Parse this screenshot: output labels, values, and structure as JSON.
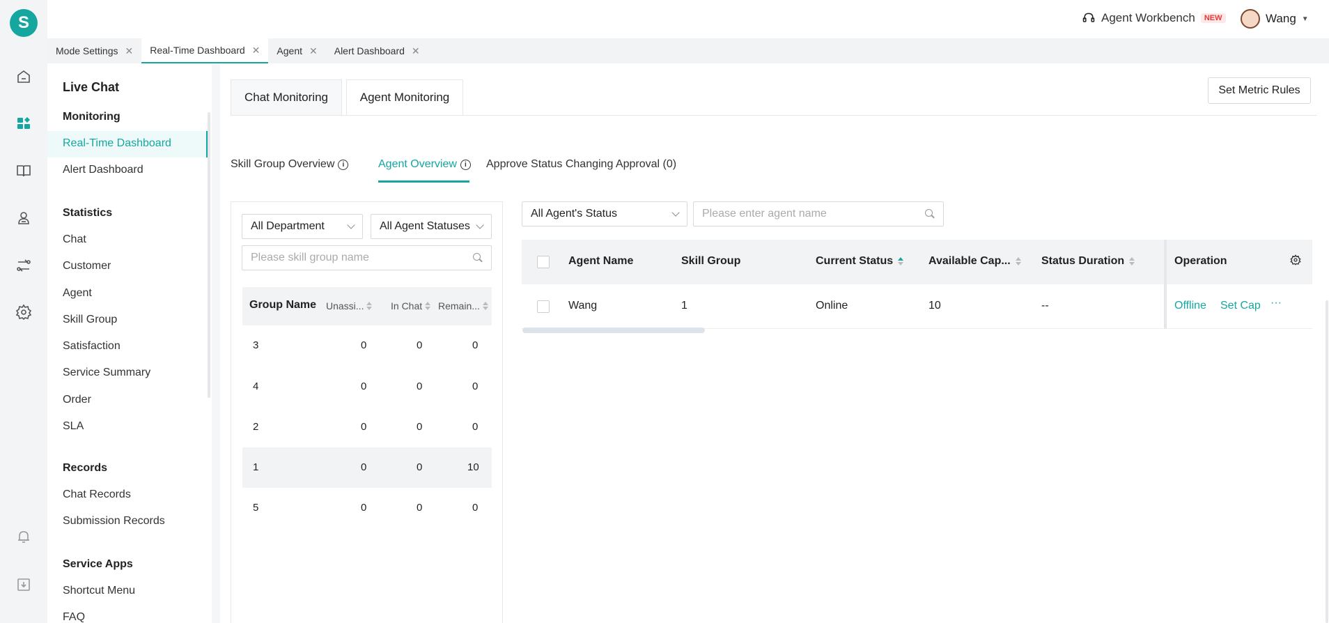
{
  "rail": {
    "logo_letter": "S",
    "icons": [
      "home-icon",
      "dashboard-icon",
      "knowledge-book-icon",
      "agent-person-icon",
      "routing-icon",
      "settings-gear-icon",
      "bell-icon",
      "download-icon"
    ]
  },
  "header": {
    "workbench_label": "Agent Workbench",
    "new_badge": "NEW",
    "user_name": "Wang"
  },
  "tabs": [
    {
      "label": "Mode Settings",
      "active": false
    },
    {
      "label": "Real-Time Dashboard",
      "active": true
    },
    {
      "label": "Agent",
      "active": false
    },
    {
      "label": "Alert Dashboard",
      "active": false
    }
  ],
  "sidebar": {
    "title": "Live Chat",
    "monitoring": "Monitoring",
    "monitoring_items": [
      "Real-Time Dashboard",
      "Alert Dashboard"
    ],
    "statistics": "Statistics",
    "statistics_items": [
      "Chat",
      "Customer",
      "Agent",
      "Skill Group",
      "Satisfaction",
      "Service Summary",
      "Order",
      "SLA"
    ],
    "records": "Records",
    "records_items": [
      "Chat Records",
      "Submission Records"
    ],
    "service_apps": "Service Apps",
    "service_apps_items": [
      "Shortcut Menu",
      "FAQ"
    ]
  },
  "main": {
    "tabs": [
      "Chat Monitoring",
      "Agent Monitoring"
    ],
    "set_metric_rules": "Set Metric Rules",
    "subtabs": [
      "Skill Group Overview",
      "Agent Overview",
      "Approve Status Changing Approval (0)"
    ]
  },
  "group_panel": {
    "department_select": "All Department",
    "status_select": "All Agent Statuses",
    "search_placeholder": "Please skill group name",
    "headers": [
      "Group Name",
      "Unassi...",
      "In Chat",
      "Remain..."
    ],
    "rows": [
      [
        "3",
        "0",
        "0",
        "0"
      ],
      [
        "4",
        "0",
        "0",
        "0"
      ],
      [
        "2",
        "0",
        "0",
        "0"
      ],
      [
        "1",
        "0",
        "0",
        "10"
      ],
      [
        "5",
        "0",
        "0",
        "0"
      ]
    ]
  },
  "agent_panel": {
    "status_select": "All Agent's Status",
    "search_placeholder": "Please enter agent name",
    "headers": [
      "Agent Name",
      "Skill Group",
      "Current Status",
      "Available Cap...",
      "Status Duration",
      "Operation"
    ],
    "rows": [
      {
        "name": "Wang",
        "skill_group": "1",
        "status": "Online",
        "capacity": "10",
        "duration": "--",
        "op_offline": "Offline",
        "op_setcap": "Set Cap",
        "op_more": "···"
      }
    ]
  }
}
